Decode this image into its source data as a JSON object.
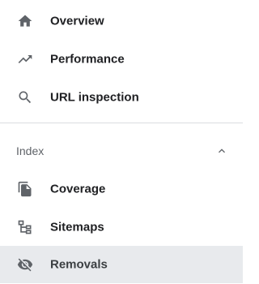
{
  "nav": {
    "items": [
      {
        "label": "Overview",
        "icon": "home-icon"
      },
      {
        "label": "Performance",
        "icon": "trending-up-icon"
      },
      {
        "label": "URL inspection",
        "icon": "search-icon"
      }
    ]
  },
  "index_section": {
    "title": "Index",
    "collapse_icon": "chevron-up-icon",
    "items": [
      {
        "label": "Coverage",
        "icon": "file-copy-icon"
      },
      {
        "label": "Sitemaps",
        "icon": "sitemap-icon"
      },
      {
        "label": "Removals",
        "icon": "visibility-off-icon",
        "selected": true
      }
    ]
  },
  "colors": {
    "text": "#202124",
    "icon": "#5f6368",
    "selected_bg": "#e8eaed",
    "divider": "#dadce0"
  }
}
